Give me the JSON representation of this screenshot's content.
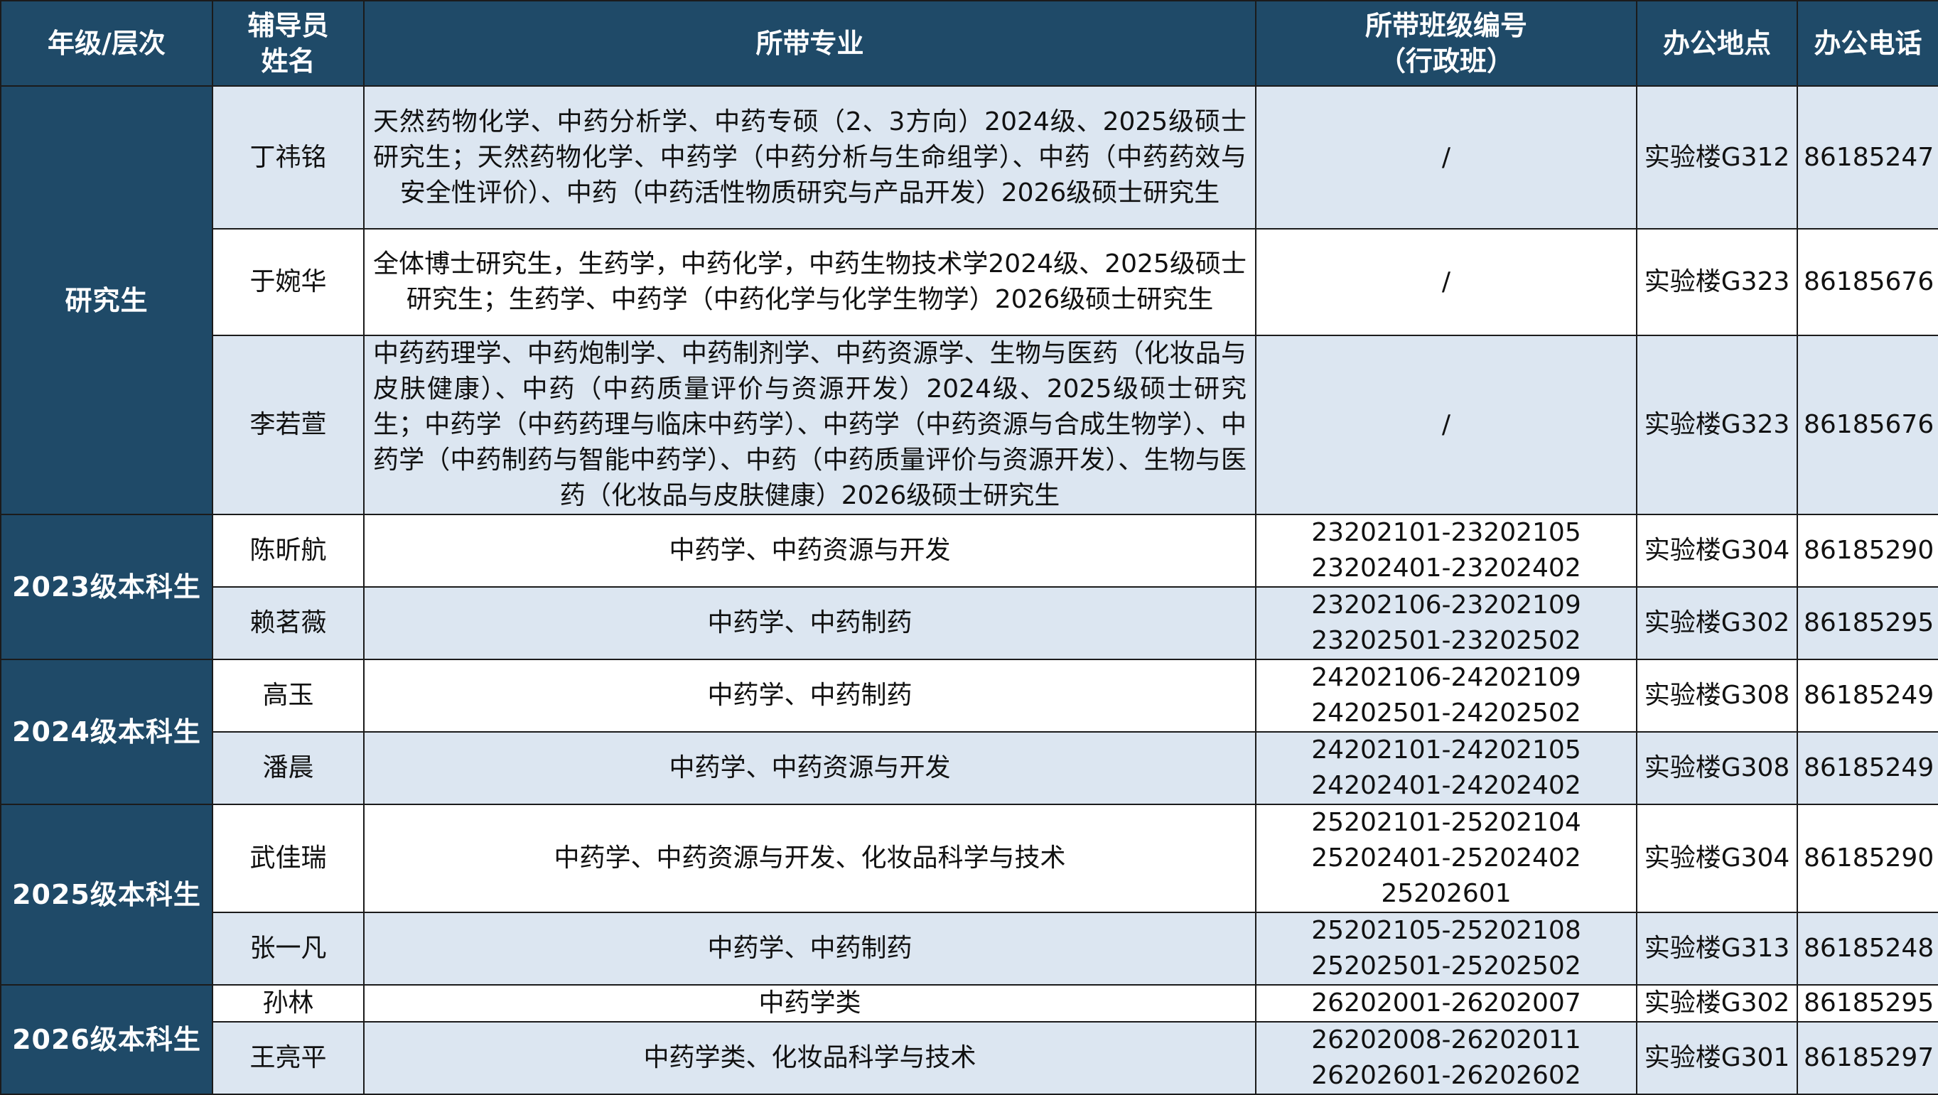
{
  "headers": {
    "level": "年级/层次",
    "name_l1": "辅导员",
    "name_l2": "姓名",
    "major": "所带专业",
    "class_l1": "所带班级编号",
    "class_l2": "（行政班）",
    "office": "办公地点",
    "phone": "办公电话"
  },
  "groups": [
    {
      "level": "研究生"
    },
    {
      "level": "2023级本科生"
    },
    {
      "level": "2024级本科生"
    },
    {
      "level": "2025级本科生"
    },
    {
      "level": "2026级本科生"
    }
  ],
  "rows": [
    {
      "name": "丁祎铭",
      "major": "天然药物化学、中药分析学、中药专硕（2、3方向）2024级、2025级硕士研究生；天然药物化学、中药学（中药分析与生命组学）、中药（中药药效与安全性评价）、中药（中药活性物质研究与产品开发）2026级硕士研究生",
      "classes": [
        "/"
      ],
      "office": "实验楼G312",
      "phone": "86185247"
    },
    {
      "name": "于婉华",
      "major": "全体博士研究生，生药学，中药化学，中药生物技术学2024级、2025级硕士研究生；生药学、中药学（中药化学与化学生物学）2026级硕士研究生",
      "classes": [
        "/"
      ],
      "office": "实验楼G323",
      "phone": "86185676"
    },
    {
      "name": "李若萱",
      "major": "中药药理学、中药炮制学、中药制剂学、中药资源学、生物与医药（化妆品与皮肤健康）、中药（中药质量评价与资源开发）2024级、2025级硕士研究生；中药学（中药药理与临床中药学）、中药学（中药资源与合成生物学）、中药学（中药制药与智能中药学）、中药（中药质量评价与资源开发）、生物与医药（化妆品与皮肤健康）2026级硕士研究生",
      "classes": [
        "/"
      ],
      "office": "实验楼G323",
      "phone": "86185676"
    },
    {
      "name": "陈昕航",
      "major": "中药学、中药资源与开发",
      "classes": [
        "23202101-23202105",
        "23202401-23202402"
      ],
      "office": "实验楼G304",
      "phone": "86185290"
    },
    {
      "name": "赖茗薇",
      "major": "中药学、中药制药",
      "classes": [
        "23202106-23202109",
        "23202501-23202502"
      ],
      "office": "实验楼G302",
      "phone": "86185295"
    },
    {
      "name": "高玉",
      "major": "中药学、中药制药",
      "classes": [
        "24202106-24202109",
        "24202501-24202502"
      ],
      "office": "实验楼G308",
      "phone": "86185249"
    },
    {
      "name": "潘晨",
      "major": "中药学、中药资源与开发",
      "classes": [
        "24202101-24202105",
        "24202401-24202402"
      ],
      "office": "实验楼G308",
      "phone": "86185249"
    },
    {
      "name": "武佳瑞",
      "major": "中药学、中药资源与开发、化妆品科学与技术",
      "classes": [
        "25202101-25202104",
        "25202401-25202402",
        "25202601"
      ],
      "office": "实验楼G304",
      "phone": "86185290"
    },
    {
      "name": "张一凡",
      "major": "中药学、中药制药",
      "classes": [
        "25202105-25202108",
        "25202501-25202502"
      ],
      "office": "实验楼G313",
      "phone": "86185248"
    },
    {
      "name": "孙林",
      "major": "中药学类",
      "classes": [
        "26202001-26202007"
      ],
      "office": "实验楼G302",
      "phone": "86185295"
    },
    {
      "name": "王亮平",
      "major": "中药学类、化妆品科学与技术",
      "classes": [
        "26202008-26202011",
        "26202601-26202602"
      ],
      "office": "实验楼G301",
      "phone": "86185297"
    }
  ],
  "colors": {
    "header_bg": "#1f4a68",
    "header_text": "#ffffff",
    "shaded_row": "#dce6f1",
    "plain_row": "#ffffff",
    "border": "#1b1b1b"
  }
}
